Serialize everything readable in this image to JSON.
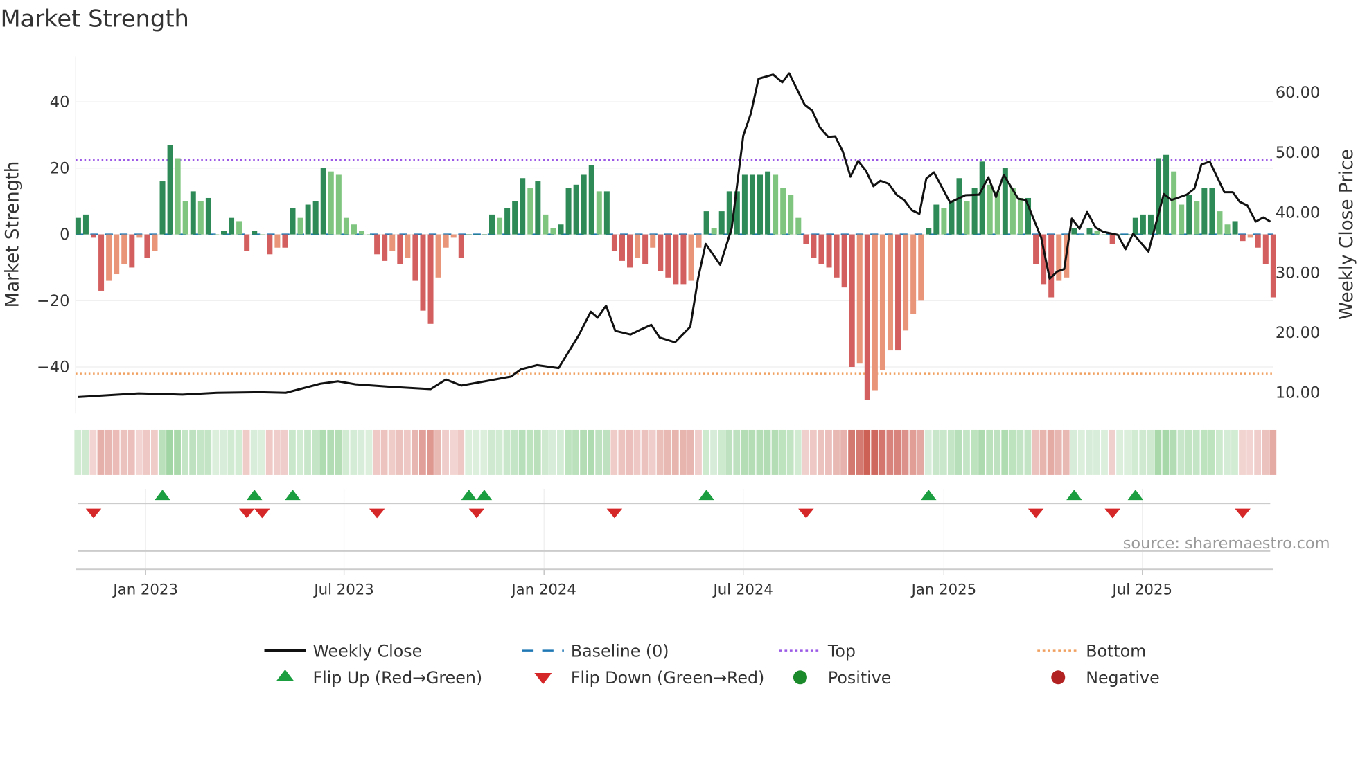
{
  "title": "Market Strength",
  "source": "source: sharemaestro.com",
  "colors": {
    "pos_strong": "#2e8b57",
    "pos_weak": "#7fc47f",
    "neg_strong": "#d35f5f",
    "neg_weak": "#e8957a",
    "close": "#111111",
    "baseline": "#1f77b4",
    "top": "#9b59e6",
    "bottom": "#f0a060",
    "flip_up": "#1a9e3f",
    "flip_down": "#d62728"
  },
  "chart_data": {
    "type": "bar+line",
    "title": "Market Strength",
    "ylabel": "Market Strength",
    "y2label": "Weekly Close Price",
    "ylim": [
      -52,
      55
    ],
    "y2lim": [
      6.5,
      68
    ],
    "yticks": [
      "40",
      "20",
      "0",
      "−20",
      "−40"
    ],
    "yticks_values": [
      40,
      20,
      0,
      -20,
      -40
    ],
    "y2ticks": [
      "60.00",
      "50.00",
      "40.00",
      "30.00",
      "20.00",
      "10.00"
    ],
    "y2ticks_values": [
      60,
      50,
      40,
      30,
      20,
      10
    ],
    "xticks": [
      "Jan 2023",
      "Jul 2023",
      "Jan 2024",
      "Jul 2024",
      "Jan 2025",
      "Jul 2025"
    ],
    "xticks_week_index": [
      8.8,
      34.7,
      60.8,
      86.8,
      113,
      138.9
    ],
    "top_level": 22.5,
    "bottom_level": -42,
    "baseline": 0,
    "strength_weekly": [
      5,
      6,
      -1,
      -17,
      -14,
      -12,
      -9,
      -10,
      -1,
      -7,
      -5,
      16,
      27,
      23,
      10,
      13,
      10,
      11,
      0,
      1,
      5,
      4,
      -5,
      1,
      0,
      -6,
      -4,
      -4,
      8,
      5,
      9,
      10,
      20,
      19,
      18,
      5,
      3,
      1,
      0,
      -6,
      -8,
      -5,
      -9,
      -7,
      -14,
      -23,
      -27,
      -13,
      -4,
      -1,
      -7,
      0,
      0,
      0,
      6,
      5,
      8,
      10,
      17,
      14,
      16,
      6,
      2,
      3,
      14,
      15,
      18,
      21,
      13,
      13,
      -5,
      -8,
      -10,
      -7,
      -9,
      -4,
      -11,
      -13,
      -15,
      -15,
      -14,
      -4,
      7,
      2,
      7,
      13,
      13,
      18,
      18,
      18,
      19,
      18,
      14,
      12,
      5,
      -3,
      -7,
      -9,
      -10,
      -13,
      -16,
      -40,
      -39,
      -50,
      -47,
      -41,
      -35,
      -35,
      -29,
      -24,
      -20,
      2,
      9,
      8,
      10,
      17,
      10,
      14,
      22,
      15,
      13,
      20,
      14,
      11,
      11,
      -9,
      -15,
      -19,
      -14,
      -13,
      2,
      0,
      2,
      1,
      0,
      -3,
      0,
      0,
      5,
      6,
      6,
      23,
      24,
      19,
      9,
      12,
      10,
      14,
      14,
      7,
      3,
      4,
      -2,
      -1,
      -4,
      -9,
      -19
    ],
    "weekly_close_points": [
      [
        0,
        9.3
      ],
      [
        7.9,
        9.9
      ],
      [
        13.6,
        9.7
      ],
      [
        18.1,
        10.0
      ],
      [
        23.7,
        10.1
      ],
      [
        27.1,
        10.0
      ],
      [
        31.6,
        11.5
      ],
      [
        33.9,
        11.9
      ],
      [
        36.2,
        11.4
      ],
      [
        40.7,
        11.0
      ],
      [
        46,
        10.6
      ],
      [
        48,
        12.2
      ],
      [
        50,
        11.2
      ],
      [
        53.1,
        11.9
      ],
      [
        56.5,
        12.7
      ],
      [
        57.8,
        13.9
      ],
      [
        59.9,
        14.6
      ],
      [
        62.7,
        14.1
      ],
      [
        65.3,
        19.5
      ],
      [
        66.9,
        23.5
      ],
      [
        67.8,
        22.5
      ],
      [
        68.9,
        24.5
      ],
      [
        70.1,
        20.3
      ],
      [
        72.1,
        19.7
      ],
      [
        73.4,
        20.5
      ],
      [
        74.8,
        21.3
      ],
      [
        75.9,
        19.2
      ],
      [
        77.9,
        18.4
      ],
      [
        79.9,
        21.0
      ],
      [
        80.9,
        29.0
      ],
      [
        81.9,
        34.8
      ],
      [
        83.8,
        31.3
      ],
      [
        85.3,
        37.4
      ],
      [
        86.8,
        52.8
      ],
      [
        87.8,
        56.5
      ],
      [
        88.8,
        62.3
      ],
      [
        90.7,
        63.0
      ],
      [
        91.9,
        61.7
      ],
      [
        92.8,
        63.2
      ],
      [
        94.8,
        58.0
      ],
      [
        95.8,
        57.0
      ],
      [
        96.8,
        54.2
      ],
      [
        97.9,
        52.6
      ],
      [
        98.8,
        52.7
      ],
      [
        99.8,
        50.2
      ],
      [
        100.8,
        46.0
      ],
      [
        101.8,
        48.6
      ],
      [
        102.8,
        47.0
      ],
      [
        103.8,
        44.4
      ],
      [
        104.7,
        45.3
      ],
      [
        105.8,
        44.8
      ],
      [
        106.8,
        43.0
      ],
      [
        107.8,
        42.1
      ],
      [
        108.8,
        40.4
      ],
      [
        109.8,
        39.8
      ],
      [
        110.7,
        45.7
      ],
      [
        111.7,
        46.7
      ],
      [
        113.8,
        41.7
      ],
      [
        115.8,
        42.9
      ],
      [
        117.6,
        43.0
      ],
      [
        118.8,
        45.9
      ],
      [
        119.8,
        42.6
      ],
      [
        120.8,
        46.3
      ],
      [
        122.7,
        42.3
      ],
      [
        123.7,
        42.1
      ],
      [
        125.7,
        35.8
      ],
      [
        126.8,
        29.0
      ],
      [
        127.8,
        30.2
      ],
      [
        128.7,
        30.6
      ],
      [
        129.7,
        39.0
      ],
      [
        130.7,
        37.3
      ],
      [
        131.7,
        40.1
      ],
      [
        132.8,
        37.5
      ],
      [
        133.8,
        36.8
      ],
      [
        135.7,
        36.3
      ],
      [
        136.7,
        33.9
      ],
      [
        137.7,
        36.5
      ],
      [
        139.7,
        33.5
      ],
      [
        141.7,
        43.1
      ],
      [
        142.7,
        42.1
      ],
      [
        144.7,
        43.0
      ],
      [
        145.7,
        44.0
      ],
      [
        146.6,
        48.0
      ],
      [
        147.7,
        48.5
      ],
      [
        149.6,
        43.4
      ],
      [
        150.7,
        43.4
      ],
      [
        151.6,
        41.8
      ],
      [
        152.6,
        41.2
      ],
      [
        153.7,
        38.5
      ],
      [
        154.7,
        39.2
      ],
      [
        155.6,
        38.5
      ]
    ],
    "flip_up_weeks": [
      11,
      23,
      28,
      51,
      53,
      82,
      111,
      130,
      138
    ],
    "flip_down_weeks": [
      2,
      22,
      24,
      39,
      52,
      70,
      95,
      125,
      135,
      152
    ]
  },
  "legend": [
    {
      "label": "Weekly Close",
      "kind": "line"
    },
    {
      "label": "Baseline (0)",
      "kind": "dash"
    },
    {
      "label": "Top",
      "kind": "dot-purple"
    },
    {
      "label": "Bottom",
      "kind": "dot-orange"
    },
    {
      "label": "Flip Up (Red→Green)",
      "kind": "tri-up"
    },
    {
      "label": "Flip Down (Green→Red)",
      "kind": "tri-down"
    },
    {
      "label": "Positive",
      "kind": "circle-green"
    },
    {
      "label": "Negative",
      "kind": "circle-red"
    }
  ]
}
